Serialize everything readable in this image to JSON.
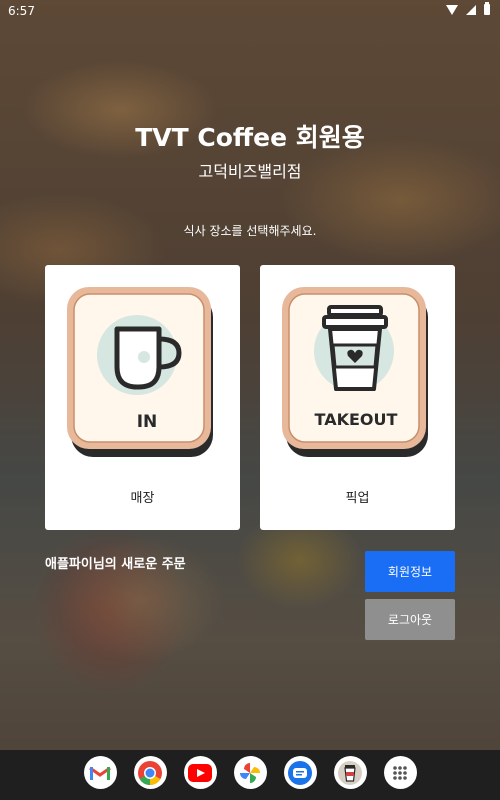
{
  "status_bar": {
    "time": "6:57"
  },
  "header": {
    "title": "TVT Coffee 회원용",
    "subtitle": "고덕비즈밸리점"
  },
  "instruction": "식사 장소를 선택해주세요.",
  "cards": [
    {
      "id": "in",
      "icon_text": "IN",
      "label": "매장",
      "icon": "coffee-cup-icon"
    },
    {
      "id": "takeout",
      "icon_text": "TAKEOUT",
      "label": "픽업",
      "icon": "takeout-cup-icon"
    }
  ],
  "order_label": "애플파이님의 새로운 주문",
  "buttons": {
    "member_info": "회원정보",
    "logout": "로그아웃"
  },
  "colors": {
    "primary_button": "#1a6ef5",
    "secondary_button": "#8f8f8f",
    "tile_border": "#e8b89a",
    "tile_fill": "#fff6ec",
    "icon_circle": "#d6e6e0"
  },
  "dock_apps": [
    {
      "name": "gmail-icon"
    },
    {
      "name": "chrome-icon"
    },
    {
      "name": "youtube-icon"
    },
    {
      "name": "photos-icon"
    },
    {
      "name": "messages-icon"
    },
    {
      "name": "tvt-coffee-app-icon"
    },
    {
      "name": "app-drawer-icon"
    }
  ]
}
